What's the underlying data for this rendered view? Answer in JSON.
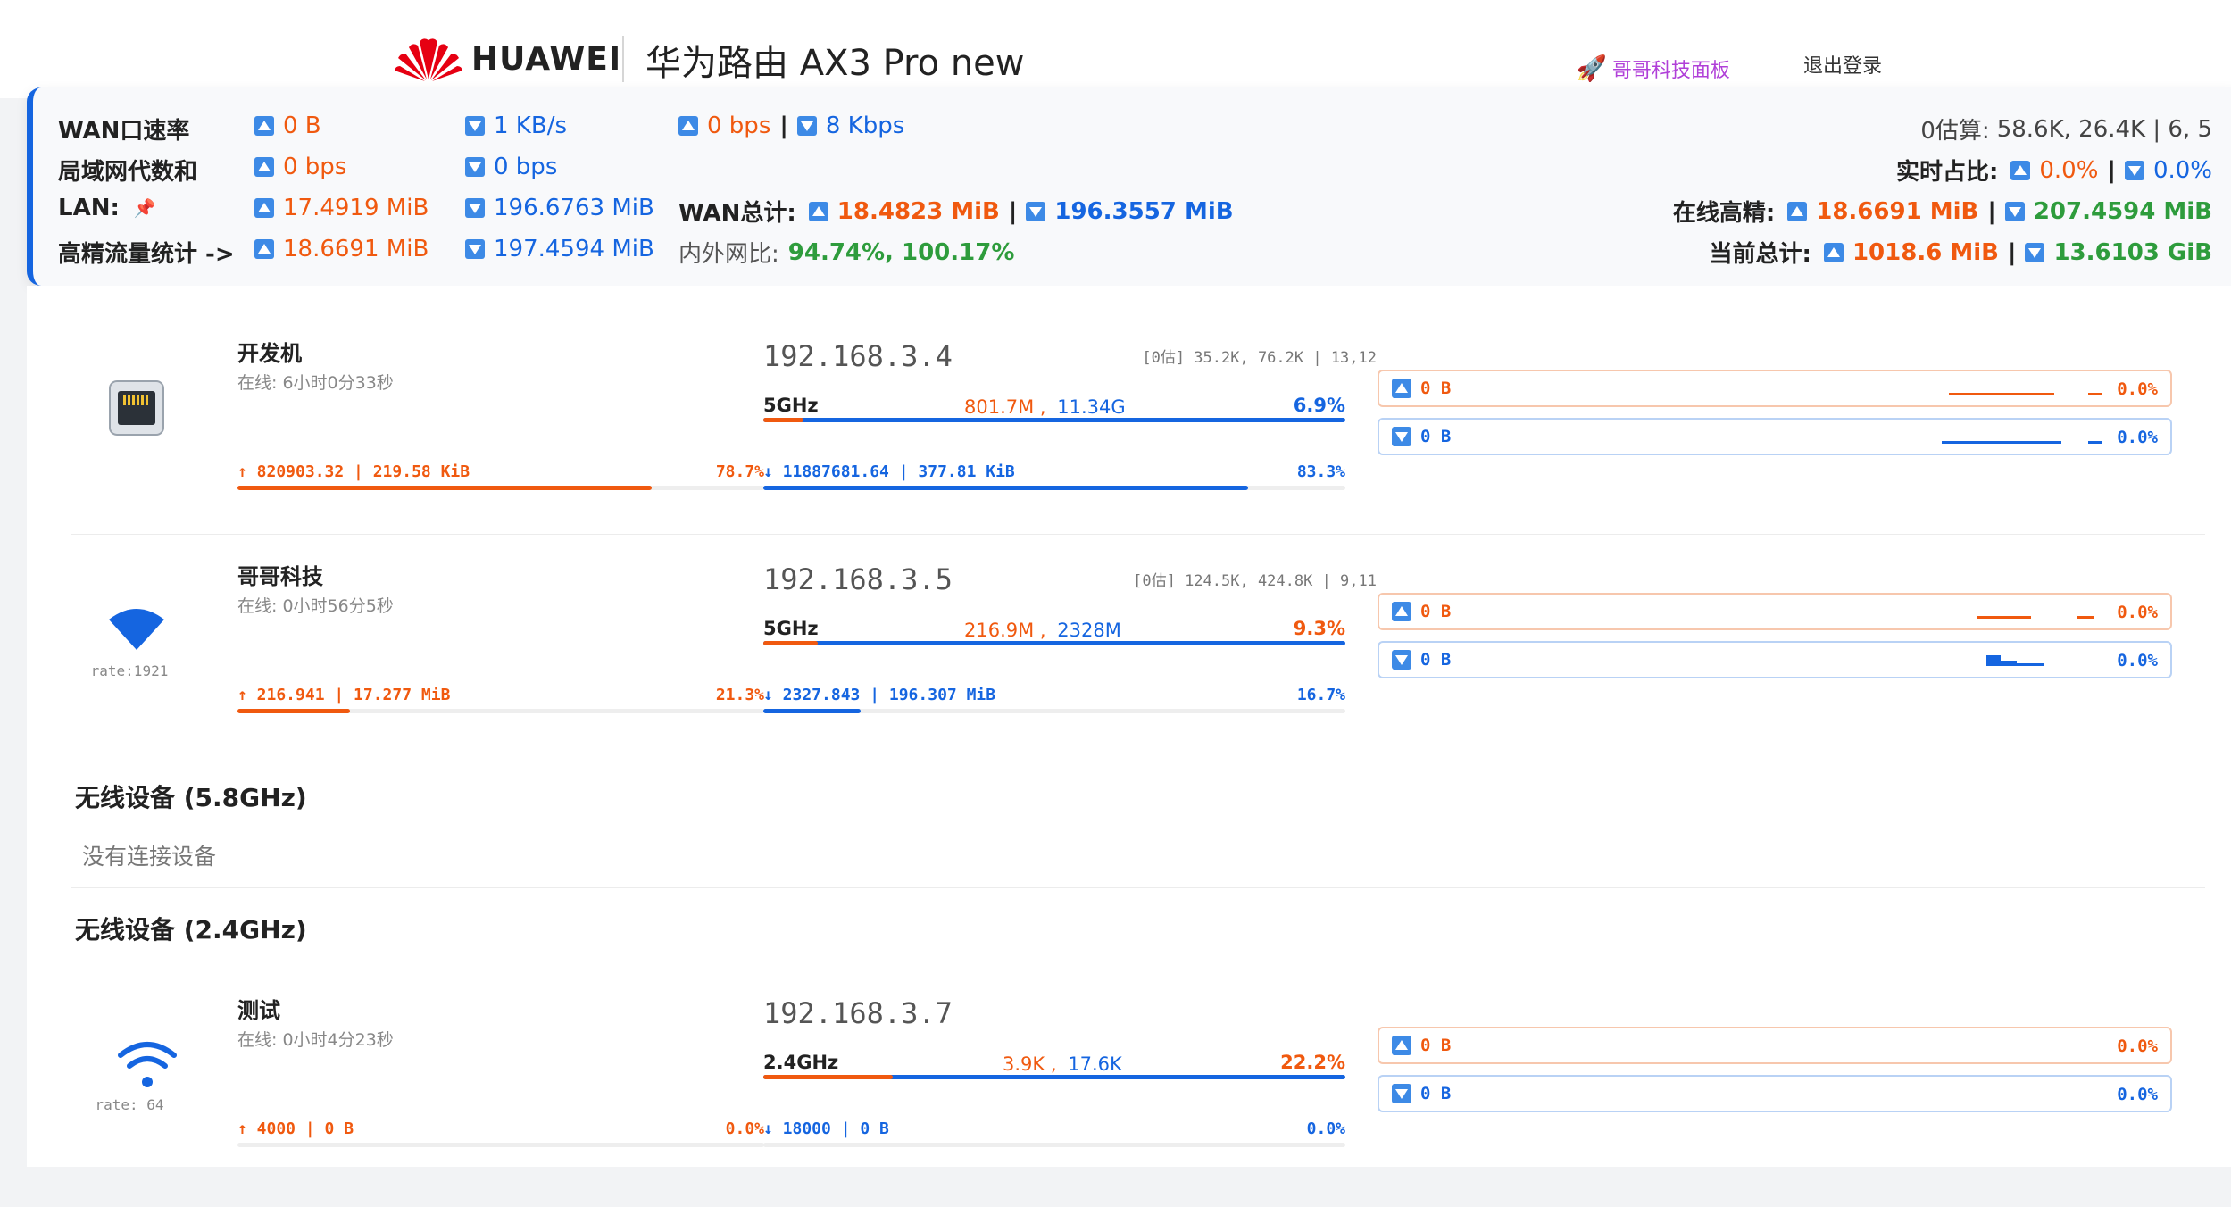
{
  "header": {
    "brand": "HUAWEI",
    "title": "华为路由 AX3 Pro new",
    "panel_link": "哥哥科技面板",
    "logout": "退出登录"
  },
  "stats": {
    "wan_rate": {
      "label": "WAN口速率",
      "up": "0 B",
      "down": "1 KB/s",
      "up_bps": "0 bps",
      "down_bps": "8 Kbps"
    },
    "lan_gen": {
      "label": "局域网代数和",
      "up": "0 bps",
      "down": "0 bps"
    },
    "lan": {
      "label": "LAN:",
      "up": "17.4919 MiB",
      "down": "196.6763 MiB"
    },
    "wan_total": {
      "label": "WAN总计:",
      "up": "18.4823 MiB",
      "down": "196.3557 MiB"
    },
    "hp_stats": {
      "label": "高精流量统计 ->",
      "up": "18.6691 MiB",
      "down": "197.4594 MiB"
    },
    "inout_ratio": {
      "label": "内外网比:",
      "value": "94.74%, 100.17%"
    },
    "zero_est": {
      "label": "0估算:",
      "value": "58.6K, 26.4K | 6, 5"
    },
    "realtime": {
      "label": "实时占比:",
      "up": "0.0%",
      "down": "0.0%"
    },
    "online_hp": {
      "label": "在线高精:",
      "up": "18.6691 MiB",
      "down": "207.4594 MiB"
    },
    "current_total": {
      "label": "当前总计:",
      "up": "1018.6 MiB",
      "down": "13.6103 GiB"
    }
  },
  "devices": [
    {
      "name": "开发机",
      "online": "在线: 6小时0分33秒",
      "rate": "",
      "ip": "192.168.3.4",
      "est": "[0估] 35.2K, 76.2K | 13,12",
      "band": "5GHz",
      "band_up": "801.7M ,",
      "band_down": "11.34G",
      "band_pct": "6.9%",
      "band_fill": 0.069,
      "tx": "↑ 820903.32 | 219.58 KiB",
      "tx_pct": "78.7%",
      "tx_fill": 0.787,
      "rx": "↓ 11887681.64 | 377.81 KiB",
      "rx_pct": "83.3%",
      "rx_fill": 0.833,
      "live_up": "0 B",
      "live_up_pct": "0.0%",
      "live_down": "0 B",
      "live_down_pct": "0.0%"
    },
    {
      "name": "哥哥科技",
      "online": "在线: 0小时56分5秒",
      "rate": "rate:1921",
      "ip": "192.168.3.5",
      "est": "[0估] 124.5K, 424.8K | 9,11",
      "band": "5GHz",
      "band_up": "216.9M ,",
      "band_down": "2328M",
      "band_pct": "9.3%",
      "band_fill": 0.093,
      "tx": "↑ 216.941 | 17.277 MiB",
      "tx_pct": "21.3%",
      "tx_fill": 0.213,
      "rx": "↓ 2327.843 | 196.307 MiB",
      "rx_pct": "16.7%",
      "rx_fill": 0.167,
      "live_up": "0 B",
      "live_up_pct": "0.0%",
      "live_down": "0 B",
      "live_down_pct": "0.0%"
    },
    {
      "name": "测试",
      "online": "在线: 0小时4分23秒",
      "rate": "rate: 64",
      "ip": "192.168.3.7",
      "est": "",
      "band": "2.4GHz",
      "band_up": "3.9K ,",
      "band_down": "17.6K",
      "band_pct": "22.2%",
      "band_fill": 0.222,
      "tx": "↑ 4000 | 0 B",
      "tx_pct": "0.0%",
      "tx_fill": 0,
      "rx": "↓ 18000 | 0 B",
      "rx_pct": "0.0%",
      "rx_fill": 0,
      "live_up": "0 B",
      "live_up_pct": "0.0%",
      "live_down": "0 B",
      "live_down_pct": "0.0%"
    }
  ],
  "sections": {
    "wireless_5g": "无线设备 (5.8GHz)",
    "no_device": "没有连接设备",
    "wireless_24g": "无线设备 (2.4GHz)"
  },
  "colors": {
    "up": "#f0590f",
    "down": "#1565e0",
    "green": "#2e9c3c",
    "accent": "#1565e0"
  }
}
